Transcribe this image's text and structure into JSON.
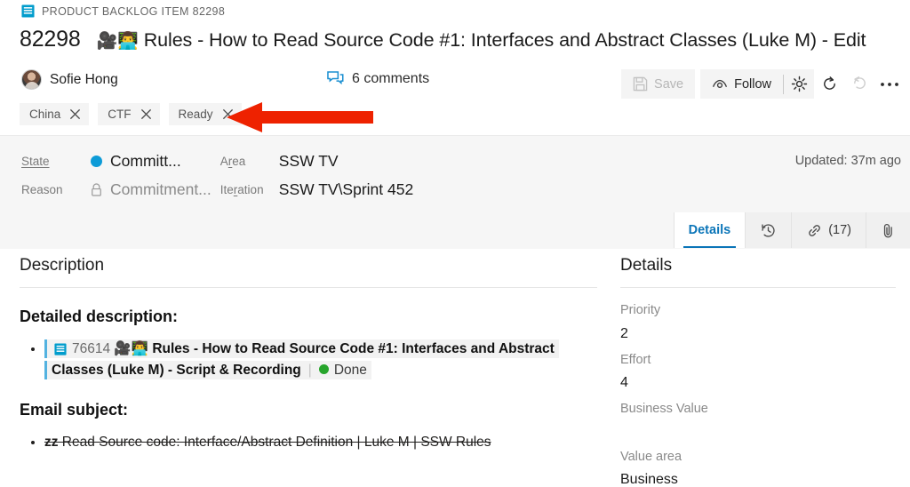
{
  "header": {
    "work_item_type": "PRODUCT BACKLOG ITEM 82298",
    "work_item_type_icon": "backlog-item-icon",
    "id": "82298",
    "title_emoji": "🎥👨‍💻",
    "title": "Rules - How to Read Source Code #1: Interfaces and Abstract Classes (Luke M) - Edit",
    "assigned_to": "Sofie Hong",
    "comments": "6 comments",
    "comments_icon": "comment-icon"
  },
  "toolbar": {
    "save_label": "Save",
    "save_icon": "save-disk-icon",
    "follow_label": "Follow",
    "follow_icon": "eye-follow-icon",
    "settings_icon": "gear-icon",
    "refresh_icon": "refresh-icon",
    "undo_icon": "undo-icon",
    "more_icon": "more-ellipsis-icon"
  },
  "tags": [
    {
      "label": "China",
      "remove_icon": "close-icon"
    },
    {
      "label": "CTF",
      "remove_icon": "close-icon"
    },
    {
      "label": "Ready",
      "remove_icon": "close-icon"
    }
  ],
  "annotation": {
    "shape": "red-left-arrow",
    "color": "#ee2200"
  },
  "meta": {
    "state_label": "State",
    "state_value": "Committ...",
    "state_color": "#0d9bd7",
    "reason_label": "Reason",
    "reason_value": "Commitment...",
    "reason_icon": "lock-icon",
    "area_label": "Area",
    "area_value": "SSW TV",
    "iteration_label": "Iteration",
    "iteration_value": "SSW TV\\Sprint 452",
    "updated": "Updated: 37m ago"
  },
  "tabs": [
    {
      "label": "Details",
      "icon": "",
      "active": true
    },
    {
      "label": "",
      "icon": "history-icon",
      "active": false
    },
    {
      "label": "(17)",
      "icon": "link-icon",
      "active": false
    },
    {
      "label": "",
      "icon": "attachment-icon",
      "active": false
    }
  ],
  "description": {
    "heading": "Description",
    "subheading_1": "Detailed description:",
    "linked_item": {
      "icon": "backlog-item-icon",
      "id": "76614",
      "emoji": "🎥👨‍💻",
      "title": "Rules - How to Read Source Code #1: Interfaces and Abstract Classes (Luke M) - Script & Recording",
      "state": "Done",
      "state_color": "#27a52c"
    },
    "subheading_2": "Email subject:",
    "email_prefix": "zz",
    "email_subject": " Read Source code: Interface/Abstract Definition | Luke M | SSW Rules"
  },
  "details": {
    "heading": "Details",
    "fields": [
      {
        "label": "Priority",
        "value": "2"
      },
      {
        "label": "Effort",
        "value": "4"
      },
      {
        "label": "Business Value",
        "value": ""
      },
      {
        "label": "Value area",
        "value": "Business"
      }
    ]
  }
}
